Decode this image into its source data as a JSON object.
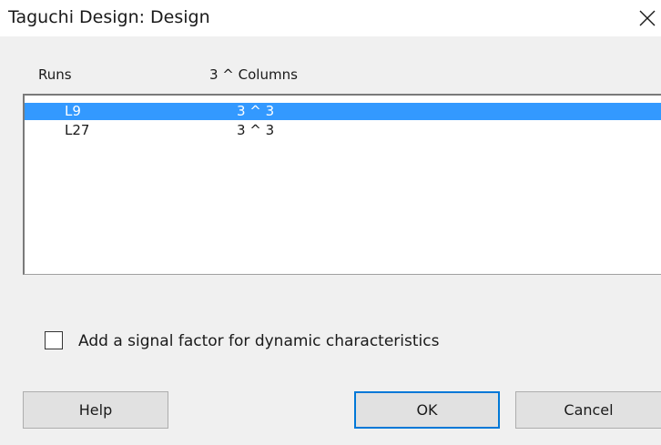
{
  "window": {
    "title": "Taguchi Design: Design"
  },
  "list": {
    "headers": {
      "runs": "Runs",
      "columns": "3 ^ Columns"
    },
    "rows": [
      {
        "runs": "L9",
        "columns": "3 ^ 3",
        "selected": true
      },
      {
        "runs": "L27",
        "columns": "3 ^ 3",
        "selected": false
      }
    ]
  },
  "options": {
    "signal_factor_label": "Add a signal factor for dynamic characteristics",
    "signal_factor_checked": false
  },
  "buttons": {
    "help": "Help",
    "ok": "OK",
    "cancel": "Cancel"
  },
  "colors": {
    "selection": "#3399ff",
    "dialog_bg": "#f0f0f0",
    "focus_border": "#0078d7"
  },
  "icons": {
    "close": "close-icon"
  }
}
